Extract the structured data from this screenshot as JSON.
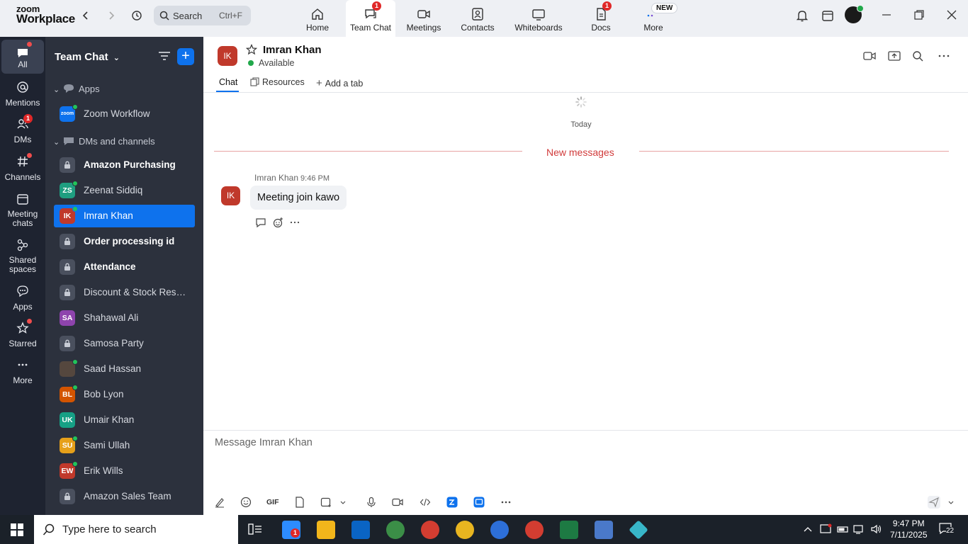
{
  "app": {
    "brand_top": "zoom",
    "brand_bottom": "Workplace"
  },
  "search": {
    "label": "Search",
    "shortcut": "Ctrl+F"
  },
  "top_tabs": [
    {
      "label": "Home",
      "icon": "home-icon"
    },
    {
      "label": "Team Chat",
      "icon": "chat-icon",
      "badge": "1"
    },
    {
      "label": "Meetings",
      "icon": "video-icon"
    },
    {
      "label": "Contacts",
      "icon": "contacts-icon"
    },
    {
      "label": "Whiteboards",
      "icon": "whiteboard-icon"
    },
    {
      "label": "Docs",
      "icon": "docs-icon",
      "badge": "1"
    },
    {
      "label": "More",
      "icon": "more-icon",
      "pill": "NEW"
    }
  ],
  "rail": [
    {
      "label": "All",
      "icon": "chat-bubble-icon"
    },
    {
      "label": "Mentions",
      "icon": "at-icon"
    },
    {
      "label": "DMs",
      "icon": "people-icon",
      "badge": "1"
    },
    {
      "label": "Channels",
      "icon": "hash-icon"
    },
    {
      "label": "Meeting chats",
      "line1": "Meeting",
      "line2": "chats",
      "icon": "calendar-icon"
    },
    {
      "label": "Shared spaces",
      "line1": "Shared",
      "line2": "spaces",
      "icon": "share-icon"
    },
    {
      "label": "Apps",
      "icon": "apps-icon"
    },
    {
      "label": "Starred",
      "icon": "star-icon"
    },
    {
      "label": "More",
      "icon": "ellipsis-icon"
    }
  ],
  "sidebar": {
    "title": "Team Chat",
    "sections": {
      "apps": "Apps",
      "dms": "DMs and channels"
    },
    "app_items": [
      {
        "name": "Zoom Workflow",
        "avatar": "zoom"
      }
    ],
    "items": [
      {
        "name": "Amazon Purchasing",
        "type": "channel",
        "bold": true
      },
      {
        "name": "Zeenat Siddiq",
        "initials": "ZS",
        "color": "#1f9e80",
        "presence": true
      },
      {
        "name": "Imran Khan",
        "initials": "IK",
        "color": "#c0392b",
        "presence": true,
        "selected": true
      },
      {
        "name": "Order processing id",
        "type": "channel",
        "bold": true
      },
      {
        "name": "Attendance",
        "type": "channel",
        "bold": true
      },
      {
        "name": "Discount & Stock Reser...",
        "type": "channel"
      },
      {
        "name": "Shahawal Ali",
        "initials": "SA",
        "color": "#8e44ad"
      },
      {
        "name": "Samosa Party",
        "type": "channel"
      },
      {
        "name": "Saad Hassan",
        "initials": "",
        "color": "#55473e",
        "presence": true
      },
      {
        "name": "Bob Lyon",
        "initials": "BL",
        "color": "#d35400",
        "presence": true
      },
      {
        "name": "Umair Khan",
        "initials": "UK",
        "color": "#16a085"
      },
      {
        "name": "Sami Ullah",
        "initials": "SU",
        "color": "#e6a01a",
        "presence": true
      },
      {
        "name": "Erik Wills",
        "initials": "EW",
        "color": "#c0392b",
        "presence": true
      },
      {
        "name": "Amazon Sales Team",
        "type": "channel"
      }
    ]
  },
  "chat": {
    "contact_initials": "IK",
    "contact_name": "Imran Khan",
    "status": "Available",
    "tabs": [
      "Chat",
      "Resources",
      "Add a tab"
    ],
    "date_divider": "Today",
    "new_messages": "New messages",
    "messages": [
      {
        "sender": "Imran Khan",
        "time": "9:46 PM",
        "text": "Meeting join kawo",
        "initials": "IK"
      }
    ],
    "compose_placeholder": "Message Imran Khan",
    "toolbar_gif": "GIF"
  },
  "taskbar": {
    "search_placeholder": "Type here to search",
    "time": "9:47 PM",
    "date": "7/11/2025",
    "notifications": "22"
  },
  "colors": {
    "accent": "#0e72ed",
    "sidebar_bg": "#2c313d",
    "rail_bg": "#1e2330",
    "alert": "#e02828"
  }
}
